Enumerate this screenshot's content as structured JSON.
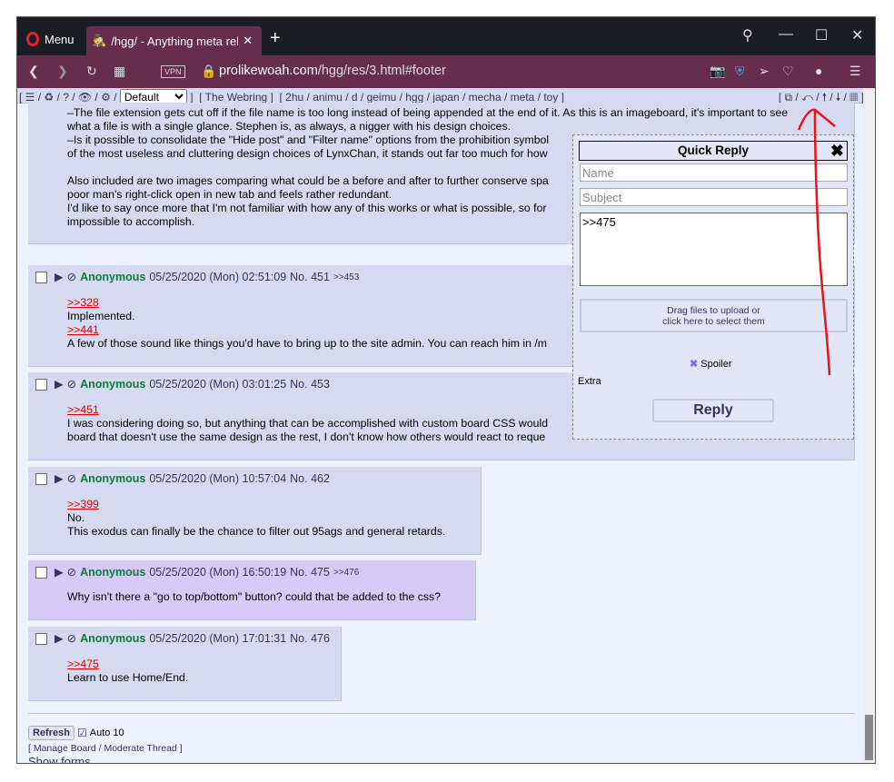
{
  "browser": {
    "menu": "Menu",
    "tab_title": "/hgg/ - Anything meta related",
    "url_host": "prolikewoah.com",
    "url_path": "/hgg/res/3.html#footer",
    "vpn": "VPN"
  },
  "navbar": {
    "left": "[ ☰ / ♻ / ? / 👁 / ⚙ /",
    "select": "Default",
    "close": "]",
    "webring": "[ The Webring ]",
    "boards": "[ 2hu / animu / d / geimu / hgg / japan / mecha / meta / toy ]",
    "right": "[ ⧉ / ↶ / 🠕 / 🠗 / ▦ ]"
  },
  "op_text": [
    "–The file extension gets cut off if the file name is too long instead of being appended at the end of it. As this is an imageboard, it's important to see",
    "what a file is with a single glance. Stephen is, as always, a nigger with his design choices.",
    "–Is it possible to consolidate the \"Hide post\" and \"Filter name\" options from the prohibition symbol",
    "of the most useless and cluttering design choices of LynxChan, it stands out far too much for how",
    "",
    "Also included are two images comparing what could be a before and after to further conserve spa",
    "poor man's right-click open in new tab and feels rather redundant.",
    "I'd like to say once more that I'm not familiar with how any of this works or what is possible, so for",
    "impossible to accomplish."
  ],
  "posts": [
    {
      "name": "Anonymous",
      "date": "05/25/2020 (Mon) 02:51:09",
      "no": "No. 451",
      "backlink": ">>453",
      "lines": [
        {
          "q": ">>328"
        },
        {
          "t": "Implemented."
        },
        {
          "q": ">>441"
        },
        {
          "t": "A few of those sound like things you'd have to bring up to the site admin. You can reach him in /m"
        }
      ]
    },
    {
      "name": "Anonymous",
      "date": "05/25/2020 (Mon) 03:01:25",
      "no": "No. 453",
      "backlink": "",
      "lines": [
        {
          "q": ">>451"
        },
        {
          "t": "I was considering doing so, but anything that can be accomplished with custom board CSS would"
        },
        {
          "t": "board that doesn't use the same design as the rest, I don't know how others would react to reque"
        }
      ]
    },
    {
      "name": "Anonymous",
      "date": "05/25/2020 (Mon) 10:57:04",
      "no": "No. 462",
      "backlink": "",
      "lines": [
        {
          "q": ">>399"
        },
        {
          "t": "No."
        },
        {
          "t": "This exodus can finally be the chance to filter out 95ags and general retards."
        }
      ]
    },
    {
      "name": "Anonymous",
      "date": "05/25/2020 (Mon) 16:50:19",
      "no": "No. 475",
      "backlink": ">>476",
      "lines": [
        {
          "t": "Why isn't there a \"go to top/bottom\" button? could that be added to the css?"
        }
      ]
    },
    {
      "name": "Anonymous",
      "date": "05/25/2020 (Mon) 17:01:31",
      "no": "No. 476",
      "backlink": "",
      "lines": [
        {
          "q": ">>475"
        },
        {
          "t": "Learn to use Home/End."
        }
      ]
    }
  ],
  "quick_reply": {
    "title": "Quick Reply",
    "name_placeholder": "Name",
    "subject_placeholder": "Subject",
    "message": ">>475",
    "drop": "Drag files to upload or",
    "drop2": "click here to select them",
    "spoiler": "Spoiler",
    "extra": "Extra",
    "reply": "Reply"
  },
  "footer": {
    "refresh": "Refresh",
    "auto": "Auto 10",
    "manage": "[ Manage Board / Moderate Thread ]",
    "show_forms": "Show forms"
  }
}
